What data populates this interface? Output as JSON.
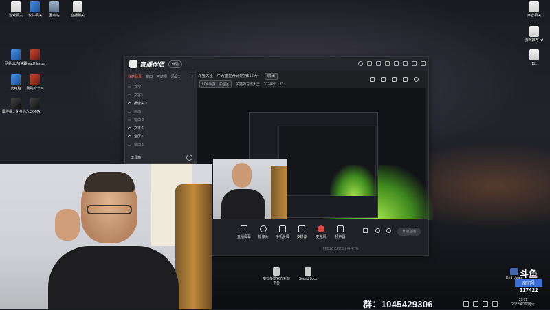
{
  "desktop": {
    "left_icons": [
      {
        "label": "游戏相关",
        "glyph": "doc"
      },
      {
        "label": "软件相关",
        "glyph": "blue"
      },
      {
        "label": "回收站",
        "glyph": "bin"
      },
      {
        "label": "直播相关",
        "glyph": "doc"
      },
      {
        "label": "网易UU加速器",
        "glyph": "blue"
      },
      {
        "label": "Dread Hunger",
        "glyph": "app"
      },
      {
        "label": "此电脑",
        "glyph": "blue"
      },
      {
        "label": "我是的一天",
        "glyph": "app"
      },
      {
        "label": "鹰伴缘：化身为人",
        "glyph": "dark"
      },
      {
        "label": "SOMA",
        "glyph": "dark"
      }
    ],
    "right_icons": [
      {
        "label": "声音相关",
        "glyph": "doc"
      },
      {
        "label": "游戏推荐.txt",
        "glyph": "doc"
      },
      {
        "label": "111",
        "glyph": "doc"
      }
    ],
    "bottom_icons": [
      {
        "label": "魔兽争霸官方对战平台",
        "glyph": "app"
      },
      {
        "label": "Sound Lock",
        "glyph": "doc"
      }
    ],
    "red_magic_label": "Red Magic"
  },
  "app": {
    "title": "直播伴侣",
    "version_badge": "体验",
    "scene_panel": {
      "tabs": [
        "我的场景",
        "窗口",
        "可选项",
        "场景1"
      ],
      "sources": [
        {
          "label": "文字4",
          "visible": false
        },
        {
          "label": "文字3",
          "visible": false
        },
        {
          "label": "摄像头 2",
          "visible": true
        },
        {
          "label": "画面",
          "visible": false
        },
        {
          "label": "窗口 2",
          "visible": false
        },
        {
          "label": "文本 1",
          "visible": true
        },
        {
          "label": "全屏 1",
          "visible": true
        },
        {
          "label": "窗口 1",
          "visible": false
        }
      ],
      "toolbox_label": "工具箱"
    },
    "room": {
      "title": "斗鱼大王：今天重金开计划第516天~",
      "edit_label": "编辑",
      "category": "LOL手游 · 综合区",
      "streamer": "护猫的习惯大王",
      "room_id": "317422",
      "fans": "33"
    },
    "toolbar": [
      {
        "label": "直播屏幕",
        "icon": "screen-icon"
      },
      {
        "label": "摄像头",
        "icon": "camera-icon"
      },
      {
        "label": "手机投屏",
        "icon": "phone-cast-icon"
      },
      {
        "label": "多媒体",
        "icon": "media-icon"
      },
      {
        "label": "麦克风",
        "icon": "microphone-icon"
      },
      {
        "label": "扬声器",
        "icon": "speaker-icon"
      }
    ],
    "start_button": "开始直播",
    "status": "FPS:60  CPU:5%  内存:7%"
  },
  "overlay": {
    "group_label": "群：1045429306",
    "room_logo": "斗鱼",
    "room_label": "房间号",
    "room_number": "317422"
  },
  "taskbar": {
    "time": "23:01",
    "date": "2022/4/16/周六"
  }
}
